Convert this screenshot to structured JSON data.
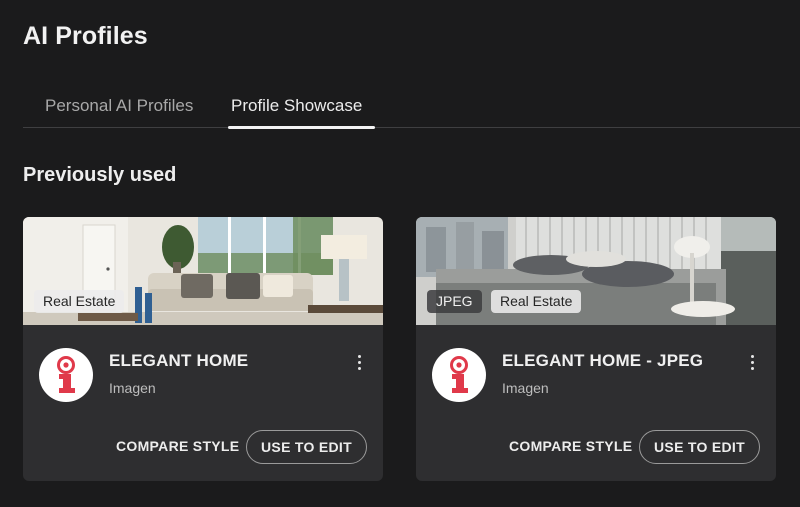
{
  "page": {
    "title": "AI Profiles"
  },
  "tabs": [
    {
      "label": "Personal AI Profiles",
      "active": false
    },
    {
      "label": "Profile Showcase",
      "active": true
    }
  ],
  "section": {
    "title": "Previously used"
  },
  "cards": [
    {
      "name": "ELEGANT HOME",
      "subtitle": "Imagen",
      "tags": [
        "Real Estate"
      ],
      "thumbnail": "living-room-photo",
      "compare_label": "COMPARE STYLE",
      "use_label": "USE TO EDIT",
      "avatar_icon": "imagen-logo-icon"
    },
    {
      "name": "ELEGANT HOME - JPEG",
      "subtitle": "Imagen",
      "tags": [
        "JPEG",
        "Real Estate"
      ],
      "thumbnail": "bedroom-photo",
      "compare_label": "COMPARE STYLE",
      "use_label": "USE TO EDIT",
      "avatar_icon": "imagen-logo-icon"
    }
  ],
  "colors": {
    "background": "#1b1b1c",
    "card": "#2e2e30",
    "brand_red": "#e0394a",
    "text_primary": "#f0f0f0",
    "text_muted": "#a8a8a8"
  }
}
